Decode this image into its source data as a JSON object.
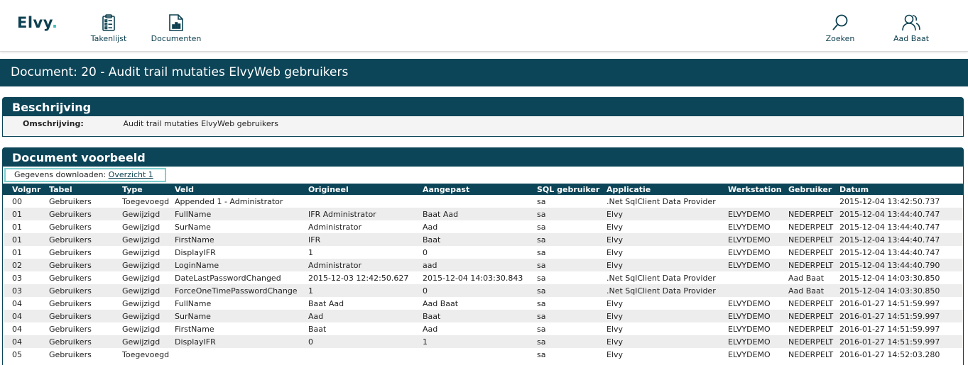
{
  "app": {
    "logo_text": "Elvy",
    "logo_dot": ".",
    "accent_color": "#3fbfb3",
    "primary_color": "#0d4558"
  },
  "nav": {
    "takenlijst": {
      "label": "Takenlijst",
      "icon": "clipboard-list-icon"
    },
    "documenten": {
      "label": "Documenten",
      "icon": "document-chart-icon"
    },
    "zoeken": {
      "label": "Zoeken",
      "icon": "search-icon"
    },
    "user": {
      "label": "Aad Baat",
      "icon": "user-icon"
    }
  },
  "page": {
    "title": "Document: 20 - Audit trail mutaties ElvyWeb gebruikers"
  },
  "description_panel": {
    "heading": "Beschrijving",
    "label": "Omschrijving:",
    "value": "Audit trail mutaties ElvyWeb gebruikers"
  },
  "document_panel": {
    "heading": "Document voorbeeld",
    "download_label": "Gegevens downloaden: ",
    "download_link": "Overzicht 1"
  },
  "table": {
    "columns": [
      "Volgnr",
      "Tabel",
      "Type",
      "Veld",
      "Origineel",
      "Aangepast",
      "SQL gebruiker",
      "Applicatie",
      "Werkstation",
      "Gebruiker",
      "Datum"
    ],
    "rows": [
      [
        "00",
        "Gebruikers",
        "Toegevoegd",
        "Appended 1 - Administrator",
        "",
        "",
        "sa",
        ".Net SqlClient Data Provider",
        "",
        "",
        "2015-12-04 13:42:50.737"
      ],
      [
        "01",
        "Gebruikers",
        "Gewijzigd",
        "FullName",
        "IFR Administrator",
        "Baat Aad",
        "sa",
        "Elvy",
        "ELVYDEMO",
        "NEDERPELT",
        "2015-12-04 13:44:40.747"
      ],
      [
        "01",
        "Gebruikers",
        "Gewijzigd",
        "SurName",
        "Administrator",
        "Aad",
        "sa",
        "Elvy",
        "ELVYDEMO",
        "NEDERPELT",
        "2015-12-04 13:44:40.747"
      ],
      [
        "01",
        "Gebruikers",
        "Gewijzigd",
        "FirstName",
        "IFR",
        "Baat",
        "sa",
        "Elvy",
        "ELVYDEMO",
        "NEDERPELT",
        "2015-12-04 13:44:40.747"
      ],
      [
        "01",
        "Gebruikers",
        "Gewijzigd",
        "DisplayIFR",
        "1",
        "0",
        "sa",
        "Elvy",
        "ELVYDEMO",
        "NEDERPELT",
        "2015-12-04 13:44:40.747"
      ],
      [
        "02",
        "Gebruikers",
        "Gewijzigd",
        "LoginName",
        "Administrator",
        "aad",
        "sa",
        "Elvy",
        "ELVYDEMO",
        "NEDERPELT",
        "2015-12-04 13:44:40.790"
      ],
      [
        "03",
        "Gebruikers",
        "Gewijzigd",
        "DateLastPasswordChanged",
        "2015-12-03 12:42:50.627",
        "2015-12-04 14:03:30.843",
        "sa",
        ".Net SqlClient Data Provider",
        "",
        "Aad Baat",
        "2015-12-04 14:03:30.850"
      ],
      [
        "03",
        "Gebruikers",
        "Gewijzigd",
        "ForceOneTimePasswordChange",
        "1",
        "0",
        "sa",
        ".Net SqlClient Data Provider",
        "",
        "Aad Baat",
        "2015-12-04 14:03:30.850"
      ],
      [
        "04",
        "Gebruikers",
        "Gewijzigd",
        "FullName",
        "Baat Aad",
        "Aad Baat",
        "sa",
        "Elvy",
        "ELVYDEMO",
        "NEDERPELT",
        "2016-01-27 14:51:59.997"
      ],
      [
        "04",
        "Gebruikers",
        "Gewijzigd",
        "SurName",
        "Aad",
        "Baat",
        "sa",
        "Elvy",
        "ELVYDEMO",
        "NEDERPELT",
        "2016-01-27 14:51:59.997"
      ],
      [
        "04",
        "Gebruikers",
        "Gewijzigd",
        "FirstName",
        "Baat",
        "Aad",
        "sa",
        "Elvy",
        "ELVYDEMO",
        "NEDERPELT",
        "2016-01-27 14:51:59.997"
      ],
      [
        "04",
        "Gebruikers",
        "Gewijzigd",
        "DisplayIFR",
        "0",
        "1",
        "sa",
        "Elvy",
        "ELVYDEMO",
        "NEDERPELT",
        "2016-01-27 14:51:59.997"
      ],
      [
        "05",
        "Gebruikers",
        "Toegevoegd",
        "",
        "",
        "",
        "sa",
        "Elvy",
        "ELVYDEMO",
        "NEDERPELT",
        "2016-01-27 14:52:03.280"
      ]
    ]
  }
}
